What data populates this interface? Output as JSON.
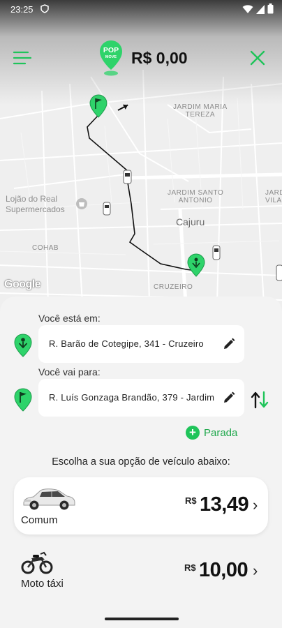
{
  "status_bar": {
    "time": "23:25"
  },
  "header": {
    "price": "R$ 0,00",
    "logo_text_top": "POP",
    "logo_text_bottom": "MOVE"
  },
  "map": {
    "labels": {
      "jardim_maria_tereza": [
        "JARDIM MARIA",
        "TEREZA"
      ],
      "jardim_santo_antonio": [
        "JARDIM SANTO",
        "ANTONIO"
      ],
      "jardim_vila": [
        "JARDI",
        "VILA"
      ],
      "lojao": [
        "Lojão do Real",
        "Supermercados"
      ],
      "cajuru": "Cajuru",
      "cohab": "COHAB",
      "cruzeiro": "CRUZEIRO"
    },
    "attribution": "Google"
  },
  "trip": {
    "origin_label": "Você está em:",
    "origin_value": "R. Barão de Cotegipe, 341 - Cruzeiro",
    "destination_label": "Você vai para:",
    "destination_value": "R. Luís Gonzaga Brandão, 379 - Jardim",
    "add_stop_label": "Parada"
  },
  "vehicles": {
    "title": "Escolha a sua opção de veículo abaixo:",
    "items": [
      {
        "name": "Comum",
        "currency": "R$",
        "price": "13,49",
        "selected": true
      },
      {
        "name": "Moto táxi",
        "currency": "R$",
        "price": "10,00",
        "selected": false
      }
    ]
  },
  "colors": {
    "brand_green": "#1fc45a",
    "pin_green": "#2ed36a"
  }
}
